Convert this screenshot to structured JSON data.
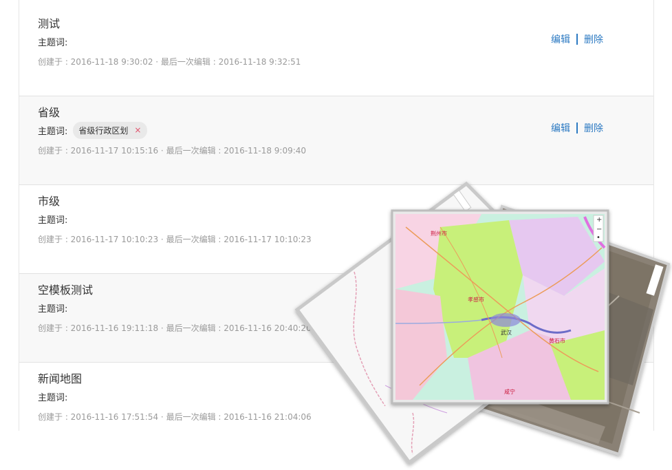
{
  "maps": [
    {
      "title": "测试",
      "keyword_label": "主题词:",
      "tags": [],
      "meta": "创建于 : 2016-11-18 9:30:02 · 最后一次编辑 : 2016-11-18 9:32:51",
      "edit_label": "编辑",
      "delete_label": "删除"
    },
    {
      "title": "省级",
      "keyword_label": "主题词:",
      "tags": [
        {
          "label": "省级行政区划",
          "remove": "×"
        }
      ],
      "meta": "创建于 : 2016-11-17 10:15:16 · 最后一次编辑 : 2016-11-18 9:09:40",
      "edit_label": "编辑",
      "delete_label": "删除"
    },
    {
      "title": "市级",
      "keyword_label": "主题词:",
      "tags": [],
      "meta": "创建于 : 2016-11-17 10:10:23 · 最后一次编辑 : 2016-11-17 10:10:23"
    },
    {
      "title": "空模板测试",
      "keyword_label": "主题词:",
      "tags": [],
      "meta": "创建于 : 2016-11-16 19:11:18 · 最后一次编辑 : 2016-11-16 20:40:20"
    },
    {
      "title": "新闻地图",
      "keyword_label": "主题词:",
      "tags": [],
      "meta": "创建于 : 2016-11-16 17:51:54 · 最后一次编辑 : 2016-11-16 21:04:06"
    }
  ],
  "map_overlay": {
    "zoom_in": "+",
    "zoom_out": "−",
    "compass": "•",
    "city_labels": [
      "武汉",
      "孝感市",
      "黄石市",
      "咸宁",
      "荆州市"
    ]
  },
  "colors": {
    "link": "#2b79c2",
    "tag_remove": "#e0506a"
  }
}
